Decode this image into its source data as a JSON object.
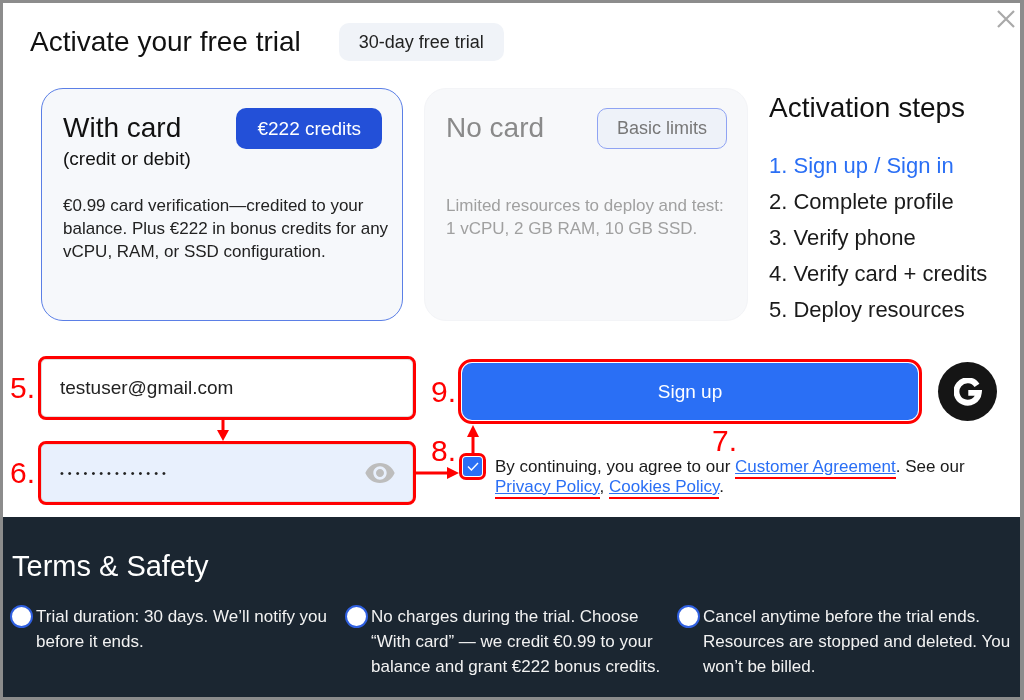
{
  "dialog": {
    "title": "Activate your free trial",
    "badge": "30-day free trial"
  },
  "plans": [
    {
      "title": "With card",
      "subtitle": "(credit or debit)",
      "badge": "€222 credits",
      "description": "€0.99 card verification—credited to your balance. Plus €222 in bonus credits for any vCPU, RAM, or SSD configuration.",
      "selected": true
    },
    {
      "title": "No card",
      "badge": "Basic limits",
      "description": "Limited resources to deploy and test: 1 vCPU, 2 GB RAM, 10 GB SSD.",
      "selected": false
    }
  ],
  "activation_steps": {
    "title": "Activation steps",
    "steps": [
      {
        "label": "1. Sign up / Sign in",
        "current": true
      },
      {
        "label": "2. Complete profile",
        "current": false
      },
      {
        "label": "3. Verify phone",
        "current": false
      },
      {
        "label": "4. Verify card + credits",
        "current": false
      },
      {
        "label": "5. Deploy resources",
        "current": false
      }
    ]
  },
  "signup_form": {
    "email_field": {
      "value": "testuser@gmail.com",
      "annotation": {
        "label": "5.",
        "arrow": true
      }
    },
    "password_field": {
      "value": "••••••••••••••",
      "annotation": {
        "label": "6.",
        "arrow": true
      }
    },
    "sign_up_button": {
      "label": "Sign up",
      "annotation": {
        "label": "9."
      }
    },
    "consent": {
      "checked": true,
      "checkbox_annotation": {
        "label": "8.",
        "arrow": true
      },
      "links_annotation": {
        "label": "7."
      },
      "parts": [
        {
          "kind": "text",
          "text": "By continuing, you agree to our "
        },
        {
          "kind": "link",
          "text": "Customer Agreement",
          "annotated": true
        },
        {
          "kind": "text",
          "text": ". See our "
        },
        {
          "kind": "link",
          "text": "Privacy Policy",
          "annotated": true
        },
        {
          "kind": "text",
          "text": ", "
        },
        {
          "kind": "link",
          "text": "Cookies Policy",
          "annotated": true
        },
        {
          "kind": "text",
          "text": "."
        }
      ]
    }
  },
  "terms": {
    "title": "Terms & Safety",
    "items": [
      {
        "text": "Trial duration: 30 days. We’ll notify you before it ends."
      },
      {
        "text": "No charges during the trial. Choose “With card” — we credit €0.99 to your balance and grant €222 bonus credits."
      },
      {
        "text": "Cancel anytime before the trial ends. Resources are stopped and deleted. You won’t be billed."
      }
    ]
  }
}
